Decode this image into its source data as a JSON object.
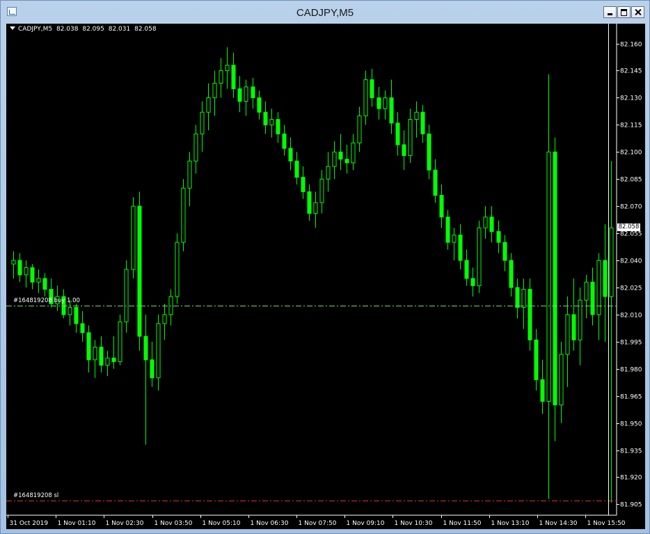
{
  "window": {
    "title": "CADJPY,M5"
  },
  "header": {
    "symbol": "CADJPY,M5",
    "open": "82.038",
    "high": "82.095",
    "low": "82.031",
    "close": "82.058"
  },
  "current_price_tag": "82.058",
  "orders": {
    "entry_label": "#164819208 buy 1.00",
    "entry_price": 82.015,
    "entry_color": "#7bd67b",
    "sl_label": "#164819208 sl",
    "sl_price": 81.907,
    "sl_color": "#e03030"
  },
  "colors": {
    "candle": "#00ff00",
    "background": "#000000",
    "axis": "#ffffff"
  },
  "chart_data": {
    "type": "candlestick",
    "symbol": "CADJPY",
    "timeframe": "M5",
    "ylim": [
      81.899,
      82.171
    ],
    "y_ticks": [
      "82.160",
      "82.145",
      "82.130",
      "82.115",
      "82.100",
      "82.085",
      "82.070",
      "82.055",
      "82.040",
      "82.025",
      "82.010",
      "81.995",
      "81.980",
      "81.965",
      "81.950",
      "81.935",
      "81.920",
      "81.905"
    ],
    "x_ticks": [
      "31 Oct 2019",
      "1 Nov 01:10",
      "1 Nov 02:30",
      "1 Nov 03:50",
      "1 Nov 05:10",
      "1 Nov 06:30",
      "1 Nov 07:50",
      "1 Nov 09:10",
      "1 Nov 10:30",
      "1 Nov 11:50",
      "1 Nov 13:10",
      "1 Nov 14:30",
      "1 Nov 15:50"
    ],
    "candles": [
      [
        82.038,
        82.045,
        82.03,
        82.04
      ],
      [
        82.04,
        82.044,
        82.028,
        82.032
      ],
      [
        82.032,
        82.04,
        82.025,
        82.036
      ],
      [
        82.036,
        82.038,
        82.024,
        82.028
      ],
      [
        82.028,
        82.035,
        82.022,
        82.03
      ],
      [
        82.03,
        82.033,
        82.02,
        82.024
      ],
      [
        82.024,
        82.03,
        82.014,
        82.016
      ],
      [
        82.016,
        82.026,
        82.012,
        82.02
      ],
      [
        82.02,
        82.024,
        82.008,
        82.01
      ],
      [
        82.01,
        82.018,
        82.004,
        82.014
      ],
      [
        82.014,
        82.016,
        82.0,
        82.005
      ],
      [
        82.005,
        82.012,
        81.995,
        82.0
      ],
      [
        82.0,
        82.004,
        81.978,
        81.985
      ],
      [
        81.985,
        81.996,
        81.975,
        81.992
      ],
      [
        81.992,
        81.998,
        81.978,
        81.982
      ],
      [
        81.982,
        81.99,
        81.976,
        81.986
      ],
      [
        81.986,
        81.998,
        81.98,
        81.984
      ],
      [
        81.984,
        82.01,
        81.982,
        82.006
      ],
      [
        82.006,
        82.04,
        82.0,
        82.035
      ],
      [
        82.035,
        82.075,
        82.03,
        82.07
      ],
      [
        82.07,
        82.078,
        81.99,
        81.998
      ],
      [
        81.998,
        82.01,
        81.938,
        81.985
      ],
      [
        81.985,
        81.995,
        81.97,
        81.975
      ],
      [
        81.975,
        82.01,
        81.968,
        82.005
      ],
      [
        82.005,
        82.016,
        81.996,
        82.01
      ],
      [
        82.01,
        82.024,
        82.004,
        82.02
      ],
      [
        82.02,
        82.055,
        82.016,
        82.05
      ],
      [
        82.05,
        82.085,
        82.045,
        82.08
      ],
      [
        82.08,
        82.1,
        82.07,
        82.095
      ],
      [
        82.095,
        82.115,
        82.088,
        82.11
      ],
      [
        82.11,
        82.128,
        82.1,
        82.122
      ],
      [
        82.122,
        82.138,
        82.112,
        82.13
      ],
      [
        82.13,
        82.145,
        82.12,
        82.138
      ],
      [
        82.138,
        82.152,
        82.13,
        82.145
      ],
      [
        82.145,
        82.158,
        82.135,
        82.148
      ],
      [
        82.148,
        82.155,
        82.13,
        82.135
      ],
      [
        82.135,
        82.142,
        82.122,
        82.128
      ],
      [
        82.128,
        82.14,
        82.12,
        82.136
      ],
      [
        82.136,
        82.141,
        82.124,
        82.13
      ],
      [
        82.13,
        82.134,
        82.118,
        82.122
      ],
      [
        82.122,
        82.128,
        82.11,
        82.115
      ],
      [
        82.115,
        82.124,
        82.108,
        82.118
      ],
      [
        82.118,
        82.122,
        82.105,
        82.11
      ],
      [
        82.11,
        82.115,
        82.098,
        82.102
      ],
      [
        82.102,
        82.108,
        82.09,
        82.095
      ],
      [
        82.095,
        82.1,
        82.082,
        82.086
      ],
      [
        82.086,
        82.092,
        82.074,
        82.078
      ],
      [
        82.078,
        82.082,
        82.062,
        82.066
      ],
      [
        82.066,
        82.078,
        82.058,
        82.072
      ],
      [
        82.072,
        82.09,
        82.066,
        82.085
      ],
      [
        82.085,
        82.1,
        82.078,
        82.092
      ],
      [
        82.092,
        82.106,
        82.085,
        82.1
      ],
      [
        82.1,
        82.11,
        82.09,
        82.096
      ],
      [
        82.096,
        82.104,
        82.088,
        82.094
      ],
      [
        82.094,
        82.11,
        82.09,
        82.105
      ],
      [
        82.105,
        82.125,
        82.1,
        82.12
      ],
      [
        82.12,
        82.145,
        82.115,
        82.14
      ],
      [
        82.14,
        82.146,
        82.125,
        82.13
      ],
      [
        82.13,
        82.136,
        82.118,
        82.124
      ],
      [
        82.124,
        82.134,
        82.118,
        82.13
      ],
      [
        82.13,
        82.14,
        82.11,
        82.116
      ],
      [
        82.116,
        82.122,
        82.098,
        82.104
      ],
      [
        82.104,
        82.112,
        82.09,
        82.098
      ],
      [
        82.098,
        82.124,
        82.094,
        82.118
      ],
      [
        82.118,
        82.128,
        82.108,
        82.122
      ],
      [
        82.122,
        82.126,
        82.105,
        82.11
      ],
      [
        82.11,
        82.115,
        82.085,
        82.09
      ],
      [
        82.09,
        82.096,
        82.072,
        82.076
      ],
      [
        82.076,
        82.082,
        82.058,
        82.064
      ],
      [
        82.064,
        82.068,
        82.046,
        82.05
      ],
      [
        82.05,
        82.058,
        82.04,
        82.054
      ],
      [
        82.054,
        82.06,
        82.035,
        82.04
      ],
      [
        82.04,
        82.046,
        82.026,
        82.03
      ],
      [
        82.03,
        82.036,
        82.02,
        82.026
      ],
      [
        82.026,
        82.062,
        82.022,
        82.058
      ],
      [
        82.058,
        82.07,
        82.052,
        82.064
      ],
      [
        82.064,
        82.07,
        82.05,
        82.056
      ],
      [
        82.056,
        82.062,
        82.044,
        82.05
      ],
      [
        82.05,
        82.054,
        82.034,
        82.04
      ],
      [
        82.04,
        82.044,
        82.02,
        82.025
      ],
      [
        82.025,
        82.03,
        82.008,
        82.014
      ],
      [
        82.014,
        82.03,
        82.002,
        82.024
      ],
      [
        82.024,
        82.03,
        81.99,
        81.996
      ],
      [
        81.996,
        82.002,
        81.968,
        81.974
      ],
      [
        81.974,
        81.985,
        81.955,
        81.962
      ],
      [
        81.962,
        82.143,
        81.908,
        82.1
      ],
      [
        82.1,
        82.108,
        81.94,
        81.96
      ],
      [
        81.96,
        81.995,
        81.95,
        81.988
      ],
      [
        81.988,
        82.02,
        81.97,
        82.01
      ],
      [
        82.01,
        82.03,
        81.99,
        81.996
      ],
      [
        81.996,
        82.025,
        81.982,
        82.018
      ],
      [
        82.018,
        82.032,
        82.008,
        82.028
      ],
      [
        82.028,
        82.036,
        82.004,
        82.01
      ],
      [
        82.01,
        82.044,
        81.996,
        82.04
      ],
      [
        82.04,
        82.06,
        81.995,
        82.02
      ],
      [
        82.02,
        82.095,
        81.906,
        82.058
      ]
    ]
  }
}
